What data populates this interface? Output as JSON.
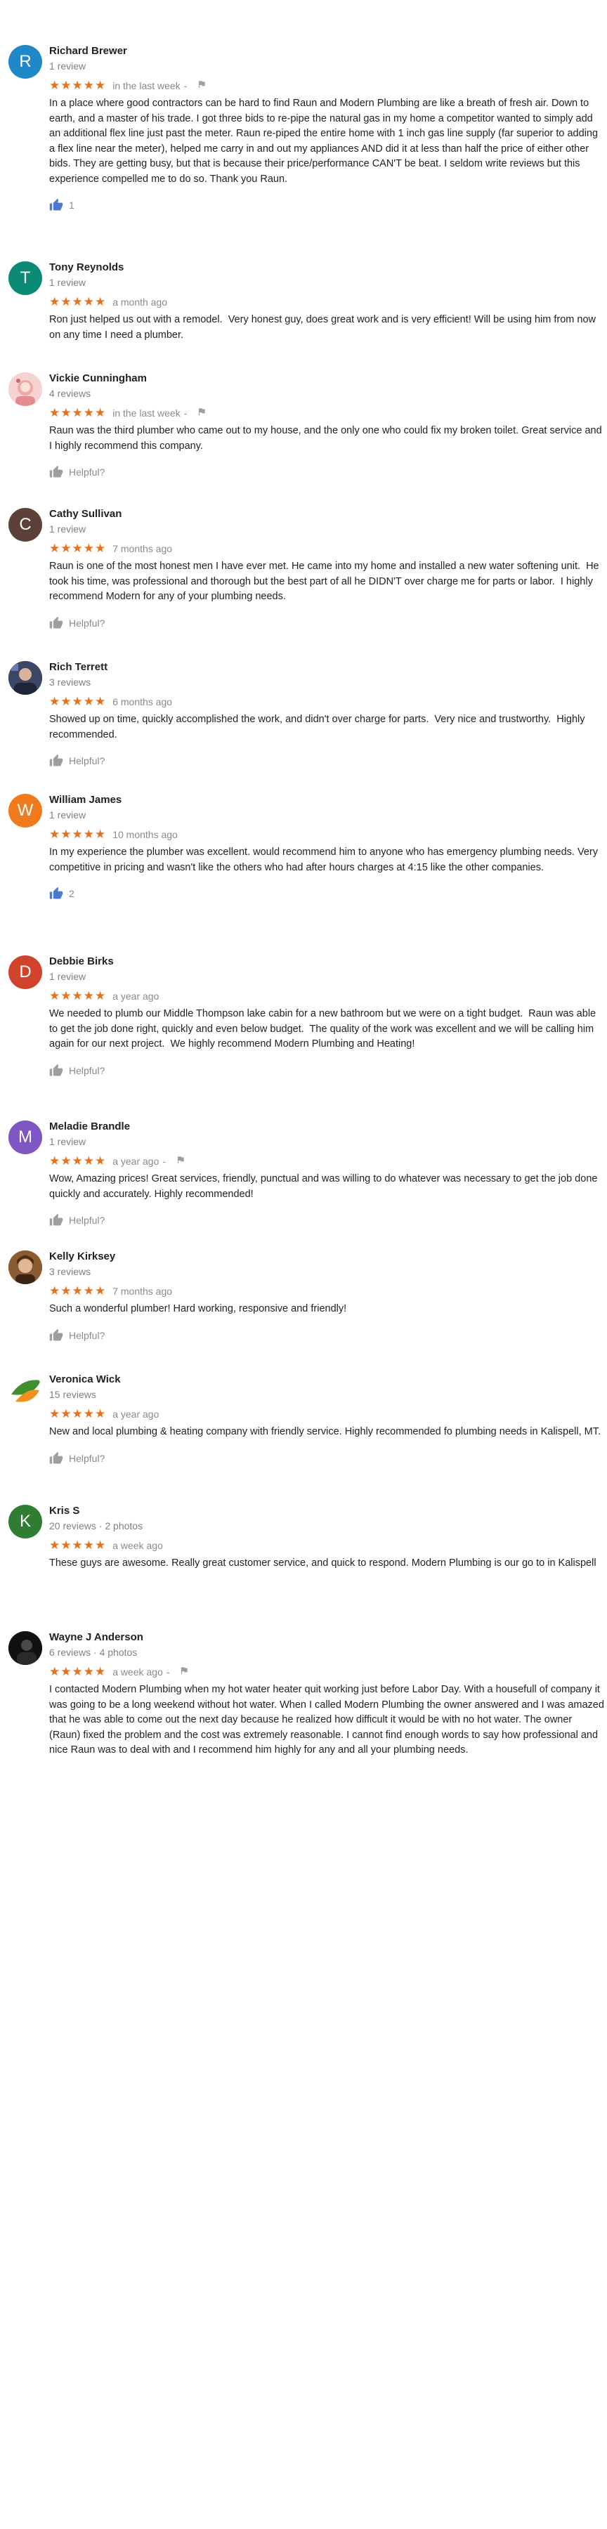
{
  "colors": {
    "star": "#e7711b",
    "meta_text": "#808080",
    "thumb_active": "#4a7bd0",
    "thumb_inactive": "#9e9e9e"
  },
  "reviews": [
    {
      "name": "Richard Brewer",
      "meta": "1 review",
      "avatar": {
        "letter": "R",
        "color": "#1e88c9"
      },
      "stars": "★★★★★",
      "rating": 5,
      "date": "in the last week",
      "has_flag": true,
      "text": "In a place where good contractors can be hard to find Raun and Modern Plumbing are like a breath of fresh air. Down to earth, and a master of his trade. I got three bids to re-pipe the natural gas in my home a competitor wanted to simply add an additional flex line just past the meter. Raun re-piped the entire home with 1 inch gas line supply (far superior to adding a flex line near the meter), helped me carry in and out my appliances AND did it at less than half the price of either other bids. They are getting busy, but that is because their price/performance CAN'T be beat. I seldom write reviews but this experience compelled me to do so. Thank you Raun.",
      "helpful": "1",
      "helpful_active": true
    },
    {
      "name": "Tony Reynolds",
      "meta": "1 review",
      "avatar": {
        "letter": "T",
        "color": "#0b8a76"
      },
      "stars": "★★★★★",
      "rating": 5,
      "date": "a month ago",
      "has_flag": false,
      "text": "Ron just helped us out with a remodel.  Very honest guy, does great work and is very efficient! Will be using him from now on any time I need a plumber.",
      "helpful": null,
      "helpful_active": false
    },
    {
      "name": "Vickie Cunningham",
      "meta": "4 reviews",
      "avatar": {
        "letter": "",
        "color": "#f2c7c7",
        "photo": "photo-pink"
      },
      "stars": "★★★★★",
      "rating": 5,
      "date": "in the last week",
      "has_flag": true,
      "text": "Raun was the third plumber who came out to my house, and the only one who could fix my broken toilet. Great service and I highly recommend this company.",
      "helpful": "Helpful?",
      "helpful_active": false
    },
    {
      "name": "Cathy Sullivan",
      "meta": "1 review",
      "avatar": {
        "letter": "C",
        "color": "#5d4037"
      },
      "stars": "★★★★★",
      "rating": 5,
      "date": "7 months ago",
      "has_flag": false,
      "text": "Raun is one of the most honest men I have ever met. He came into my home and installed a new water softening unit.  He took his time, was professional and thorough but the best part of all he DIDN'T over charge me for parts or labor.  I highly recommend Modern for any of your plumbing needs.",
      "helpful": "Helpful?",
      "helpful_active": false
    },
    {
      "name": "Rich Terrett",
      "meta": "3 reviews",
      "avatar": {
        "letter": "",
        "color": "#2e3550",
        "photo": "photo-dark"
      },
      "stars": "★★★★★",
      "rating": 5,
      "date": "6 months ago",
      "has_flag": false,
      "text": "Showed up on time, quickly accomplished the work, and didn't over charge for parts.  Very nice and trustworthy.  Highly recommended.",
      "helpful": "Helpful?",
      "helpful_active": false
    },
    {
      "name": "William James",
      "meta": "1 review",
      "avatar": {
        "letter": "W",
        "color": "#f07a1c"
      },
      "stars": "★★★★★",
      "rating": 5,
      "date": "10 months ago",
      "has_flag": false,
      "text": "In my experience the plumber was excellent. would recommend him to anyone who has emergency plumbing needs. Very competitive in pricing and wasn't like the others who had after hours charges at 4:15 like the other companies.",
      "helpful": "2",
      "helpful_active": true
    },
    {
      "name": "Debbie Birks",
      "meta": "1 review",
      "avatar": {
        "letter": "D",
        "color": "#d2432b"
      },
      "stars": "★★★★★",
      "rating": 5,
      "date": "a year ago",
      "has_flag": false,
      "text": "We needed to plumb our Middle Thompson lake cabin for a new bathroom but we were on a tight budget.  Raun was able to get the job done right, quickly and even below budget.  The quality of the work was excellent and we will be calling him again for our next project.  We highly recommend Modern Plumbing and Heating!",
      "helpful": "Helpful?",
      "helpful_active": false
    },
    {
      "name": "Meladie Brandle",
      "meta": "1 review",
      "avatar": {
        "letter": "M",
        "color": "#7e57c2"
      },
      "stars": "★★★★★",
      "rating": 5,
      "date": "a year ago",
      "has_flag": true,
      "text": "Wow, Amazing prices! Great services, friendly, punctual and was willing to do whatever was necessary to get the job done quickly and accurately. Highly recommended!",
      "helpful": "Helpful?",
      "helpful_active": false
    },
    {
      "name": "Kelly Kirksey",
      "meta": "3 reviews",
      "avatar": {
        "letter": "",
        "color": "#7a5230",
        "photo": "photo-brown"
      },
      "stars": "★★★★★",
      "rating": 5,
      "date": "7 months ago",
      "has_flag": false,
      "text": "Such a wonderful plumber! Hard working, responsive and friendly!",
      "helpful": "Helpful?",
      "helpful_active": false
    },
    {
      "name": "Veronica Wick",
      "meta": "15 reviews",
      "avatar": {
        "letter": "",
        "color": "#ffffff",
        "photo": "photo-leaf"
      },
      "stars": "★★★★★",
      "rating": 5,
      "date": "a year ago",
      "has_flag": false,
      "text": "New and local plumbing & heating company with friendly service. Highly recommended fo plumbing needs in Kalispell, MT.",
      "helpful": "Helpful?",
      "helpful_active": false
    },
    {
      "name": "Kris S",
      "meta": "20 reviews · 2 photos",
      "avatar": {
        "letter": "K",
        "color": "#2e7d32"
      },
      "stars": "★★★★★",
      "rating": 5,
      "date": "a week ago",
      "has_flag": false,
      "text": "These guys are awesome. Really great customer service, and quick to respond. Modern Plumbing is our go to in Kalispell",
      "helpful": null,
      "helpful_active": false
    },
    {
      "name": "Wayne J Anderson",
      "meta": "6 reviews · 4 photos",
      "avatar": {
        "letter": "",
        "color": "#1a1a1a",
        "photo": "photo-black"
      },
      "stars": "★★★★★",
      "rating": 5,
      "date": "a week ago",
      "has_flag": true,
      "text": "I contacted Modern Plumbing when my hot water heater quit working just before Labor Day. With a housefull of company it was going to be a long weekend without hot water. When I called Modern Plumbing the owner answered and I was amazed that he was able to come out the next day because he realized how difficult it would be with no hot water. The owner (Raun) fixed the problem and the cost was extremely reasonable. I cannot find enough words to say how professional and nice Raun was to deal with and I recommend him highly for any and all your plumbing needs.",
      "helpful": null,
      "helpful_active": false
    }
  ]
}
